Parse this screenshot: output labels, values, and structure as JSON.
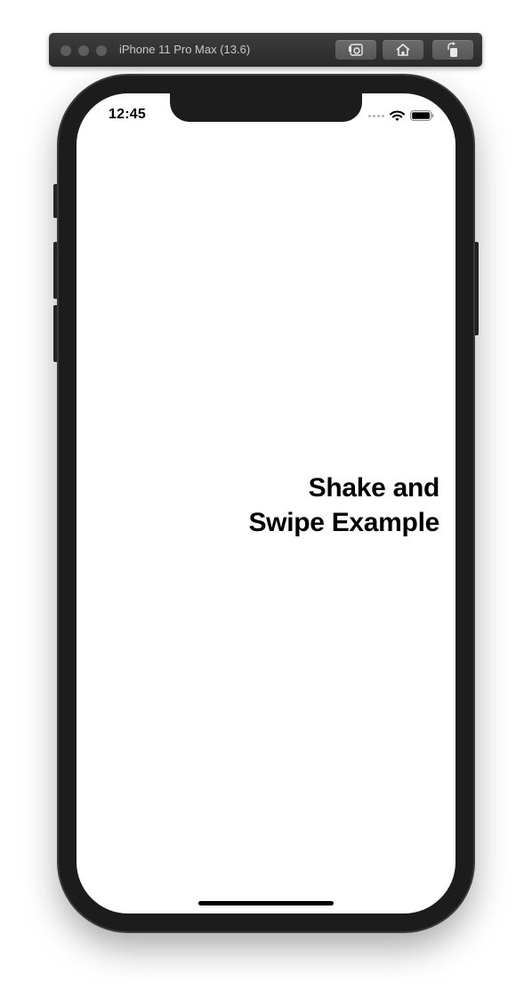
{
  "window": {
    "title": "iPhone 11 Pro Max (13.6)",
    "buttons": [
      {
        "name": "screenshot",
        "icon": "camera-icon"
      },
      {
        "name": "home",
        "icon": "home-icon"
      },
      {
        "name": "rotate",
        "icon": "rotate-icon"
      }
    ]
  },
  "status_bar": {
    "time": "12:45",
    "icons": [
      "signal-icon",
      "wifi-icon",
      "battery-icon"
    ]
  },
  "content": {
    "headline_line1": "Shake and",
    "headline_line2": "Swipe Example"
  },
  "colors": {
    "bezel": "#1c1c1c",
    "screen": "#ffffff",
    "text": "#000000"
  }
}
